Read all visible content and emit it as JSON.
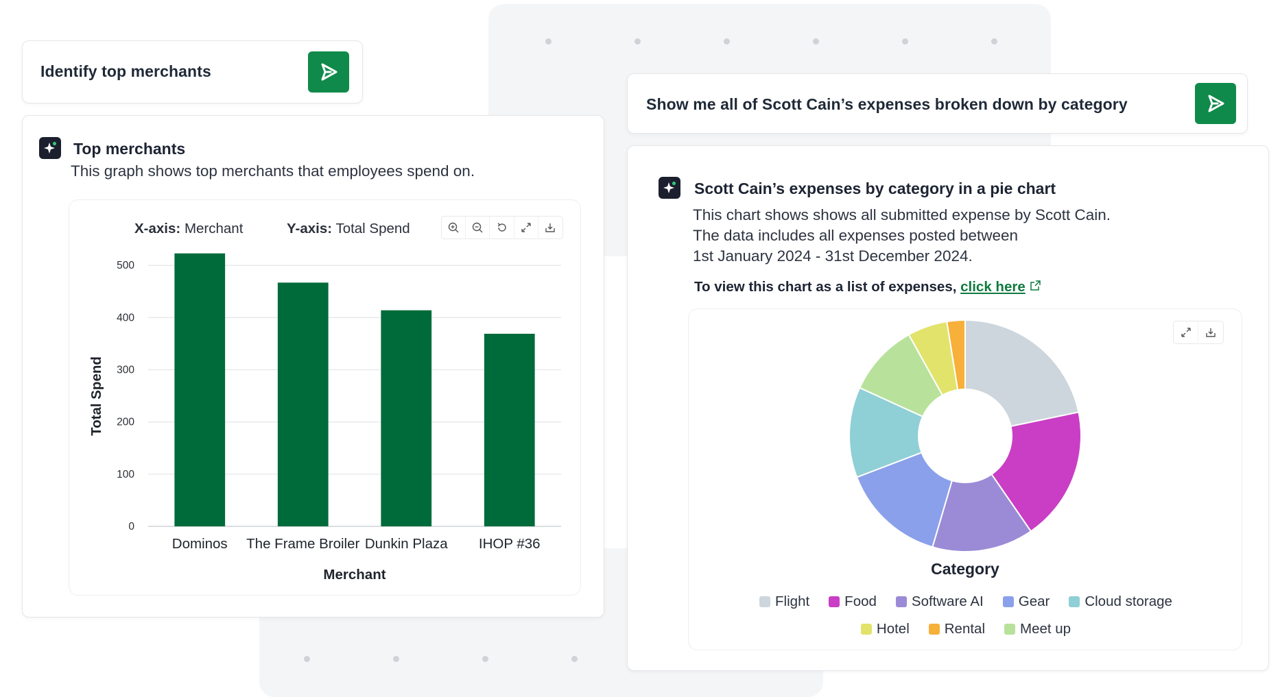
{
  "left": {
    "prompt": "Identify top merchants",
    "card_title": "Top merchants",
    "card_desc": "This graph shows top merchants that employees spend on.",
    "x_caption_key": "X-axis:",
    "x_caption_val": "Merchant",
    "y_caption_key": "Y-axis:",
    "y_caption_val": "Total Spend",
    "icons": [
      "zoom-in-icon",
      "zoom-out-icon",
      "reset-icon",
      "expand-icon",
      "download-icon"
    ]
  },
  "right": {
    "prompt": "Show me all of Scott Cain’s expenses broken down by category",
    "card_title": "Scott Cain’s expenses by category in a pie chart",
    "desc_line1": "This chart shows shows all submitted expense by Scott Cain.",
    "desc_line2": "The data includes all expenses posted between",
    "desc_line3": "1st January 2024 - 31st December 2024.",
    "view_text": "To view this chart as a list of expenses,",
    "link_text": "click here",
    "icons": [
      "expand-icon",
      "download-icon"
    ]
  },
  "colors": {
    "brand_green": "#0f8a4a",
    "bar_green": "#006b3a",
    "ai_icon_bg": "#1b1f2e"
  },
  "chart_data": [
    {
      "type": "bar",
      "categories": [
        "Dominos",
        "The Frame Broiler",
        "Dunkin Plaza",
        "IHOP #36"
      ],
      "values": [
        523,
        467,
        414,
        369
      ],
      "xlabel": "Merchant",
      "ylabel": "Total Spend",
      "ylim": [
        0,
        520
      ],
      "yticks": [
        0,
        100,
        200,
        300,
        400,
        500
      ],
      "grid": true,
      "color": "#006b3a"
    },
    {
      "type": "pie",
      "title": "Category",
      "donut": true,
      "legend_position": "bottom",
      "series": [
        {
          "name": "Flight",
          "value": 21.5,
          "color": "#cdd6dc"
        },
        {
          "name": "Food",
          "value": 18.5,
          "color": "#c93ec5"
        },
        {
          "name": "Software AI",
          "value": 14.0,
          "color": "#9b8bd6"
        },
        {
          "name": "Gear",
          "value": 14.5,
          "color": "#8aa0ea"
        },
        {
          "name": "Cloud storage",
          "value": 12.5,
          "color": "#8fcfd6"
        },
        {
          "name": "Meet up",
          "value": 10.0,
          "color": "#b8e29b"
        },
        {
          "name": "Hotel",
          "value": 5.5,
          "color": "#e2e36b"
        },
        {
          "name": "Rental",
          "value": 2.5,
          "color": "#f7b03a"
        }
      ],
      "legend_rows": [
        [
          "Flight",
          "Food",
          "Software AI",
          "Gear",
          "Cloud storage"
        ],
        [
          "Hotel",
          "Rental",
          "Meet up"
        ]
      ]
    }
  ]
}
